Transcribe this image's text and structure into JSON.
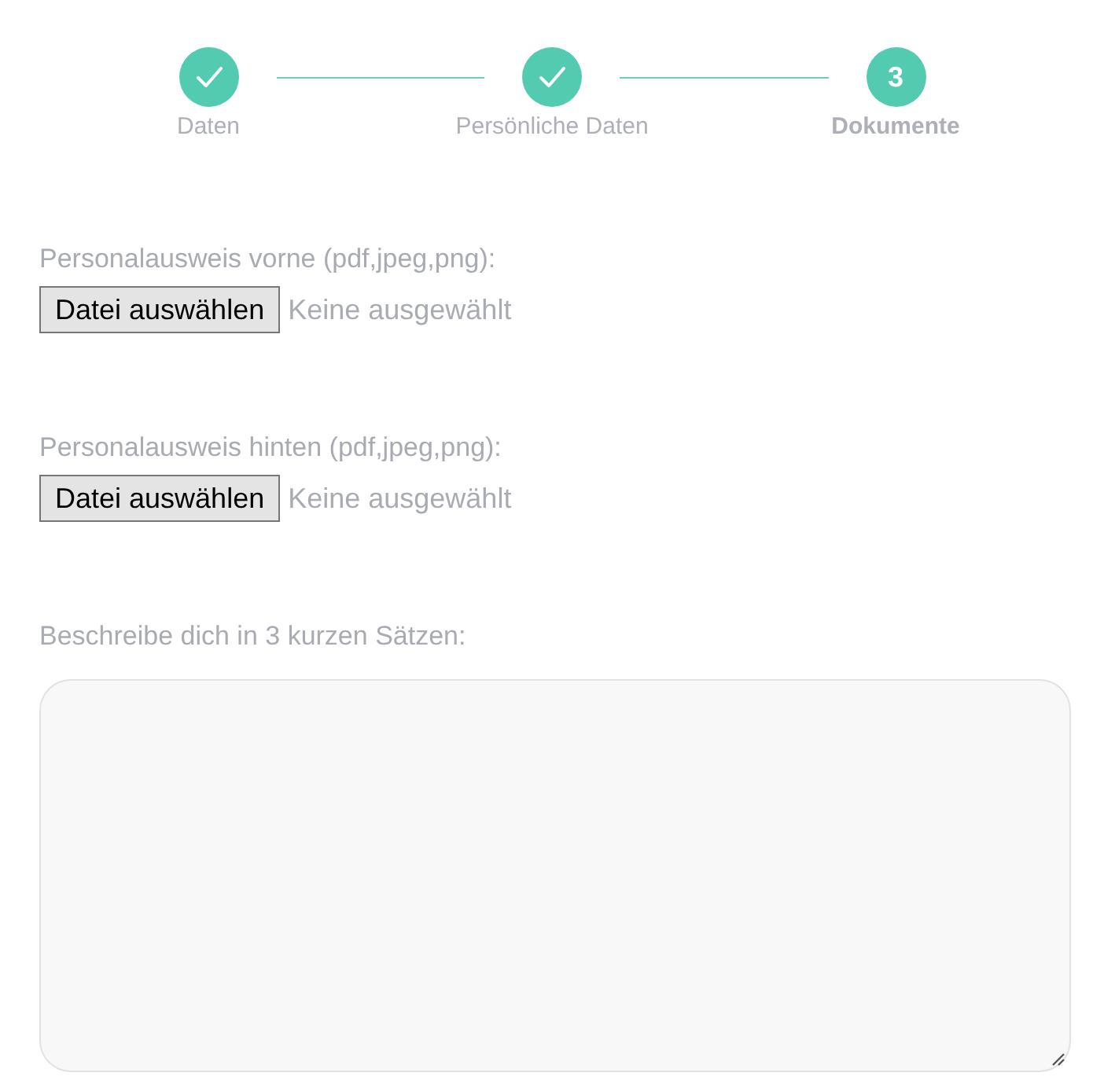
{
  "stepper": {
    "steps": [
      {
        "label": "Daten",
        "completed": true,
        "selected": false
      },
      {
        "label": "Persönliche Daten",
        "completed": true,
        "selected": false
      },
      {
        "label": "Dokumente",
        "number": "3",
        "completed": false,
        "selected": true
      }
    ]
  },
  "fields": [
    {
      "kind": "file",
      "label": "Personalausweis vorne (pdf,jpeg,png):",
      "button": "Datei auswählen",
      "status": "Keine ausgewählt"
    },
    {
      "kind": "file",
      "label": "Personalausweis hinten (pdf,jpeg,png):",
      "button": "Datei auswählen",
      "status": "Keine ausgewählt"
    },
    {
      "kind": "textarea",
      "label": "Beschreibe dich in 3 kurzen Sätzen:"
    }
  ]
}
